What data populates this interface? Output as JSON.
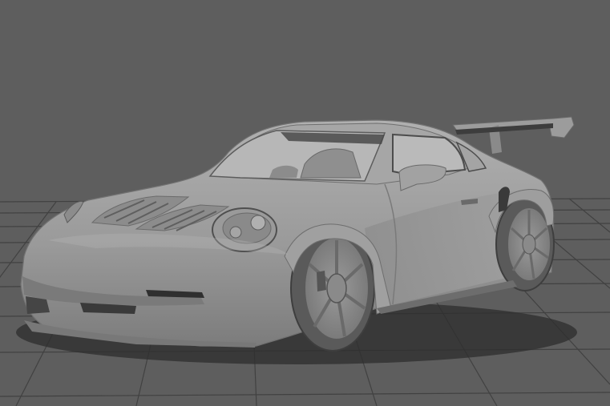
{
  "scene": {
    "subject": "car-3d-render",
    "colors": {
      "background": "#5e5e5e",
      "grid_line": "#3f3f3f",
      "body_light": "#a8a8a8",
      "body_mid": "#8e8e8e",
      "body_dark": "#6f6f6f",
      "glass": "#b5b5b5",
      "tire": "#5a5a5a",
      "shadow": "#2e2e2e"
    }
  }
}
